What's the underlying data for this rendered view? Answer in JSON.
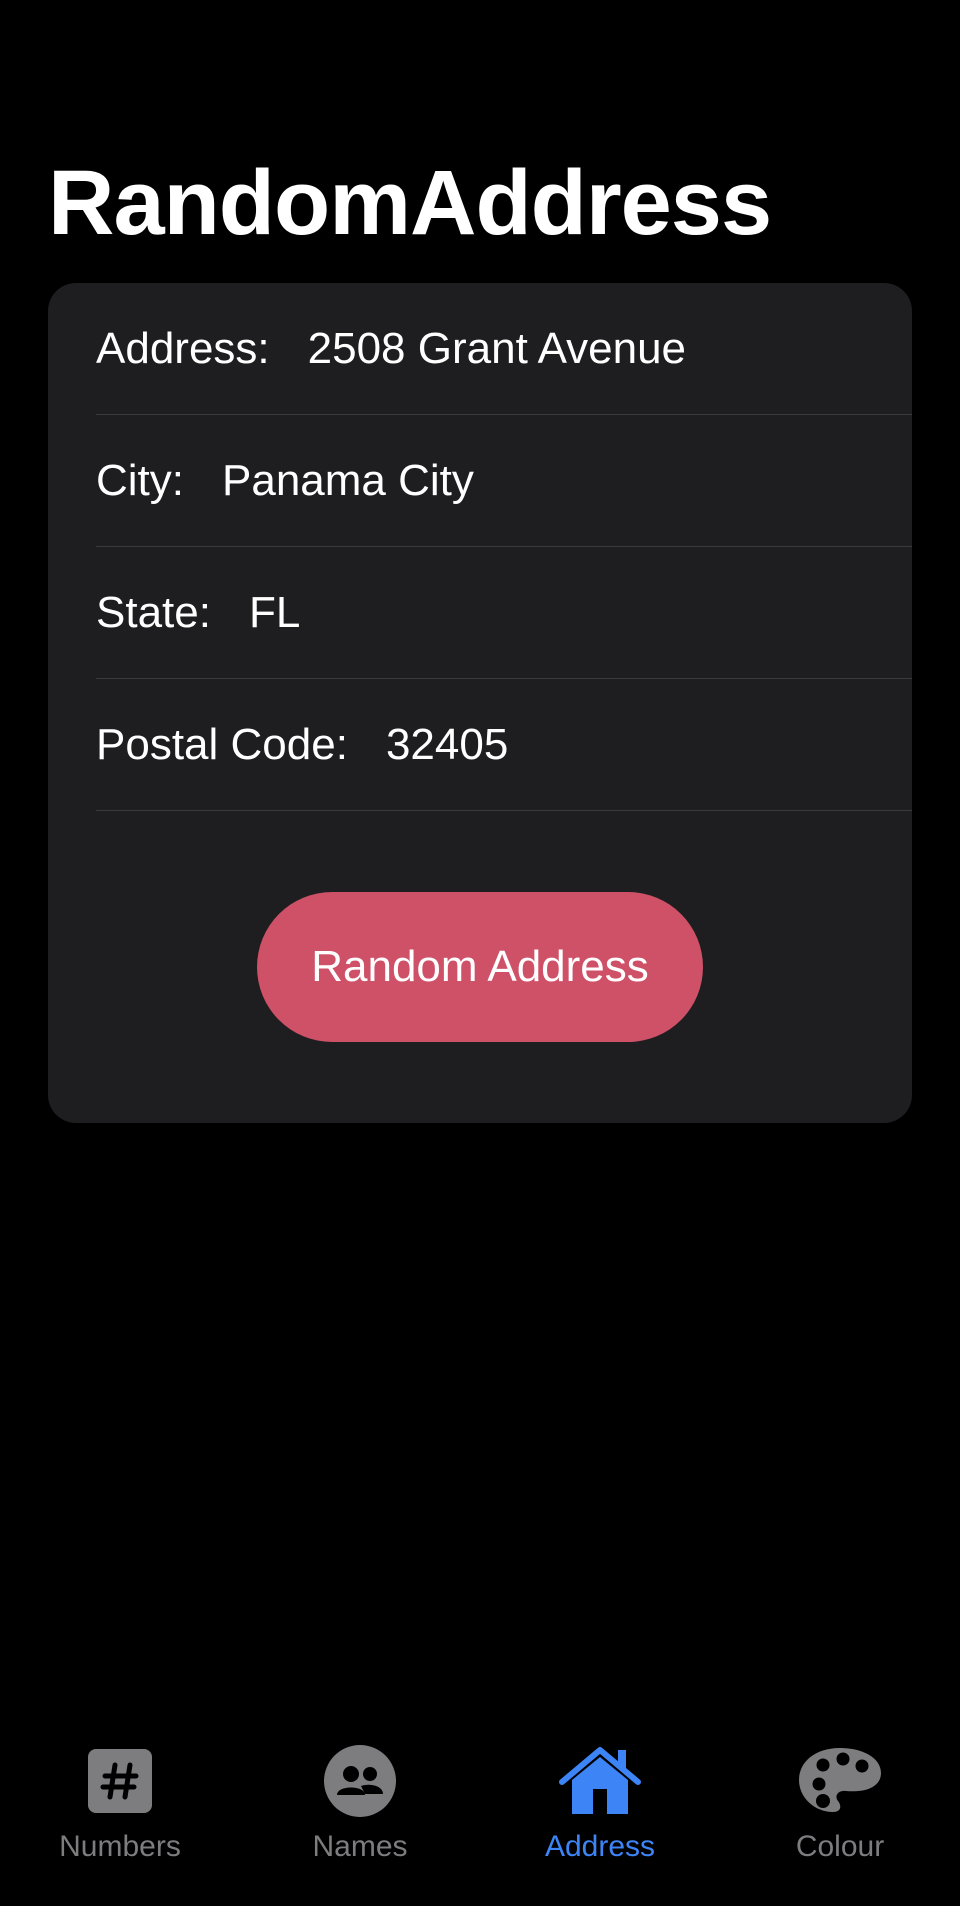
{
  "header": {
    "title": "RandomAddress"
  },
  "card": {
    "rows": [
      {
        "label": "Address:",
        "value": "2508 Grant Avenue"
      },
      {
        "label": "City:",
        "value": "Panama City"
      },
      {
        "label": "State:",
        "value": "FL"
      },
      {
        "label": "Postal Code:",
        "value": "32405"
      }
    ],
    "button_label": "Random Address"
  },
  "tabbar": {
    "tabs": [
      {
        "label": "Numbers",
        "icon": "hash-icon",
        "active": false
      },
      {
        "label": "Names",
        "icon": "people-icon",
        "active": false
      },
      {
        "label": "Address",
        "icon": "house-icon",
        "active": true
      },
      {
        "label": "Colour",
        "icon": "palette-icon",
        "active": false
      }
    ]
  },
  "colors": {
    "background": "#000000",
    "card": "#1e1e20",
    "button": "#cf5168",
    "tab_active": "#3d84f6",
    "tab_inactive": "#7d7d80"
  }
}
